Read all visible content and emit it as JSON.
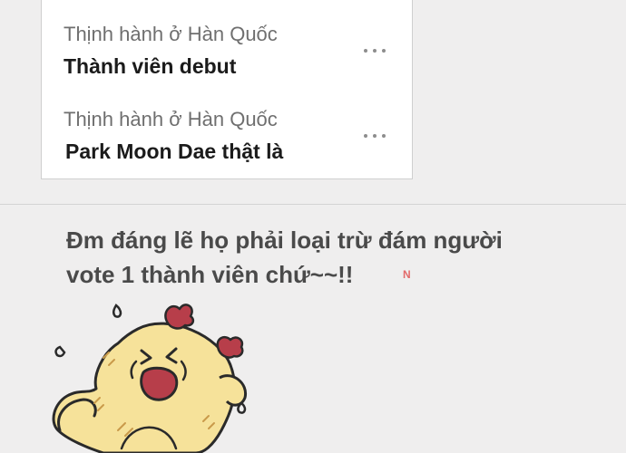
{
  "trends": [
    {
      "context": "Thịnh hành ở Hàn Quốc",
      "title": "Thành viên debut"
    },
    {
      "context": "Thịnh hành ở Hàn Quốc",
      "title": "Park Moon Dae thật là"
    }
  ],
  "post": {
    "lines": [
      "Đm đáng lẽ họ phải loại trừ đám người",
      "vote 1 thành viên chứ~~!!"
    ],
    "watermark": "N"
  },
  "sticker": {
    "icon": "crying-chick-sticker"
  },
  "colors": {
    "background": "#efeeee",
    "card": "#ffffff",
    "post_text": "#4a4a4a",
    "sticker_fill": "#f6e29a",
    "sticker_accent": "#b73e4a"
  }
}
